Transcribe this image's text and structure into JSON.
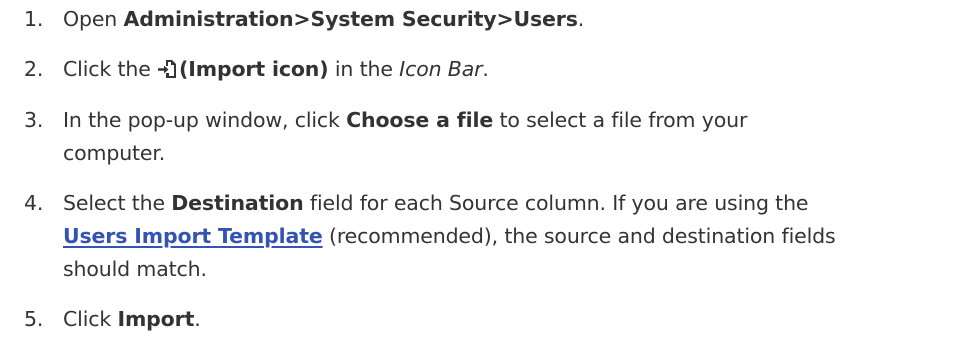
{
  "steps": [
    {
      "number": "1.",
      "before": "Open ",
      "bold": "Administration>System Security>Users",
      "after": "."
    },
    {
      "number": "2.",
      "before": "Click the ",
      "icon": "import-icon",
      "bold": "(Import icon)",
      "middle": " in the ",
      "italic": "Icon Bar",
      "after": "."
    },
    {
      "number": "3.",
      "before": "In the pop-up window, click ",
      "bold": "Choose a file",
      "after_line1": " to select a file from your",
      "line2": "computer."
    },
    {
      "number": "4.",
      "before": "Select the ",
      "bold": "Destination",
      "after_line1": " field for each Source column. If you are using the",
      "link": "Users Import Template",
      "after_link": " (recommended), the source and destination fields",
      "line3": "should match."
    },
    {
      "number": "5.",
      "before": "Click ",
      "bold": "Import",
      "after": "."
    }
  ],
  "colors": {
    "text": "#333333",
    "link": "#3454b4"
  }
}
